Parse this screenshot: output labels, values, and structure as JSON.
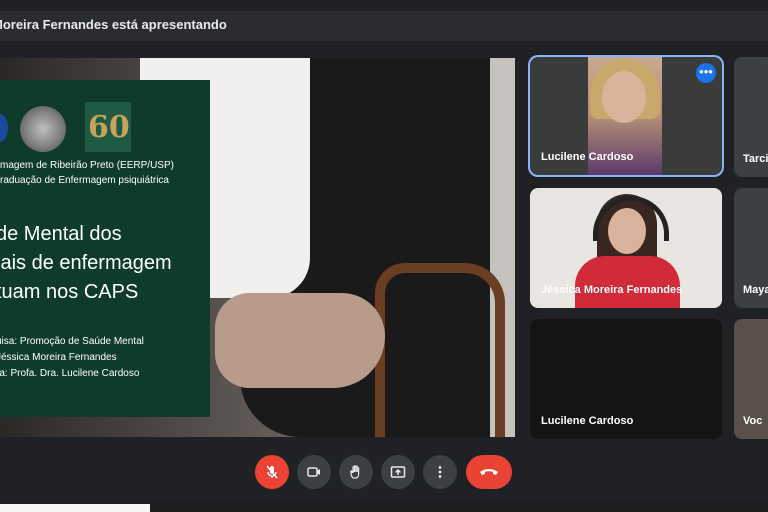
{
  "header": {
    "presenting_text": "Moreira Fernandes está apresentando"
  },
  "slide": {
    "inst_line1": "magem de Ribeirão Preto (EERP/USP)",
    "inst_line2": "raduação de Enfermagem psiquiátrica",
    "title_line1": "de Mental dos",
    "title_line2": "iais de enfermagem",
    "title_line3": "tuam nos CAPS",
    "meta_line1": "uisa: Promoção de Saúde Mental",
    "meta_line2": "Jéssica Moreira Fernandes",
    "meta_line3": "ra: Profa. Dra. Lucilene Cardoso",
    "logo_text": "60"
  },
  "participants": [
    {
      "name": "Lucilene Cardoso"
    },
    {
      "name": "Jéssica Moreira Fernandes"
    },
    {
      "name": "Lucilene Cardoso"
    }
  ],
  "partial_participants": [
    {
      "name": "Tarci"
    },
    {
      "name": "Maya"
    },
    {
      "name": "Voc"
    }
  ],
  "controls": {
    "mic": "mic-off-icon",
    "camera": "camera-icon",
    "raise_hand": "hand-icon",
    "present": "present-icon",
    "more": "more-vert-icon",
    "end_call": "end-call-icon"
  },
  "colors": {
    "active_border": "#8ab4f8",
    "danger": "#ea4335",
    "tile_bg": "#3c4043"
  }
}
